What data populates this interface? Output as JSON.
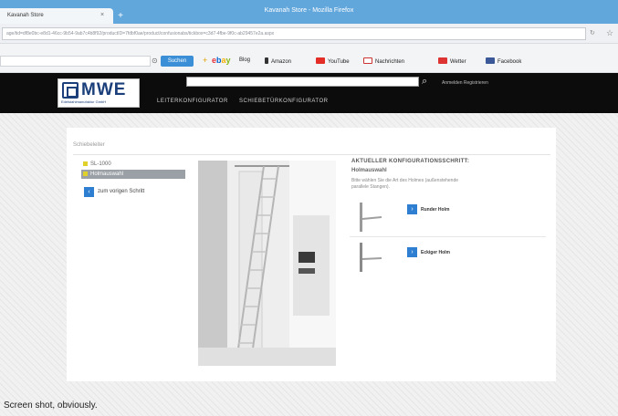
{
  "browser": {
    "window_title": "Kavanah Store - Mozilla Firefox",
    "tab_label": "Kavanah Store",
    "url": "age/tid=df8e0bc-e8d1-46cc-9b54-9ab7c4b8f92/productID=7fdbf0ae/product/confusionabs/tickbox=c3d7-4fbe-9f0c-ab29457e2a.aspx",
    "bookmarks": {
      "search_label": "Suchen",
      "items": [
        "Blog",
        "Amazon",
        "YouTube",
        "Nachrichten",
        "Wetter",
        "Facebook"
      ]
    }
  },
  "site": {
    "logo_text": "MWE",
    "logo_subtext": "Edelstahlmanufaktur GmbH",
    "account_link": "Anmelden Registrieren",
    "nav": [
      "LEITERKONFIGURATOR",
      "SCHIEBETÜRKONFIGURATOR"
    ]
  },
  "configurator": {
    "breadcrumb": "Schiebeleiter",
    "steps": [
      "SL-1000",
      "Holmauswahl"
    ],
    "back_label": "zum vorigen Schritt",
    "current_title": "AKTUELLER KONFIGURATIONSSCHRITT:",
    "current_sub": "Holmauswahl",
    "description": "Bitte wählen Sie die Art des Holmes (außenstehende parallele Stangen).",
    "options": [
      "Runder Holm",
      "Eckiger Holm"
    ]
  },
  "caption": "Screen shot, obviously."
}
